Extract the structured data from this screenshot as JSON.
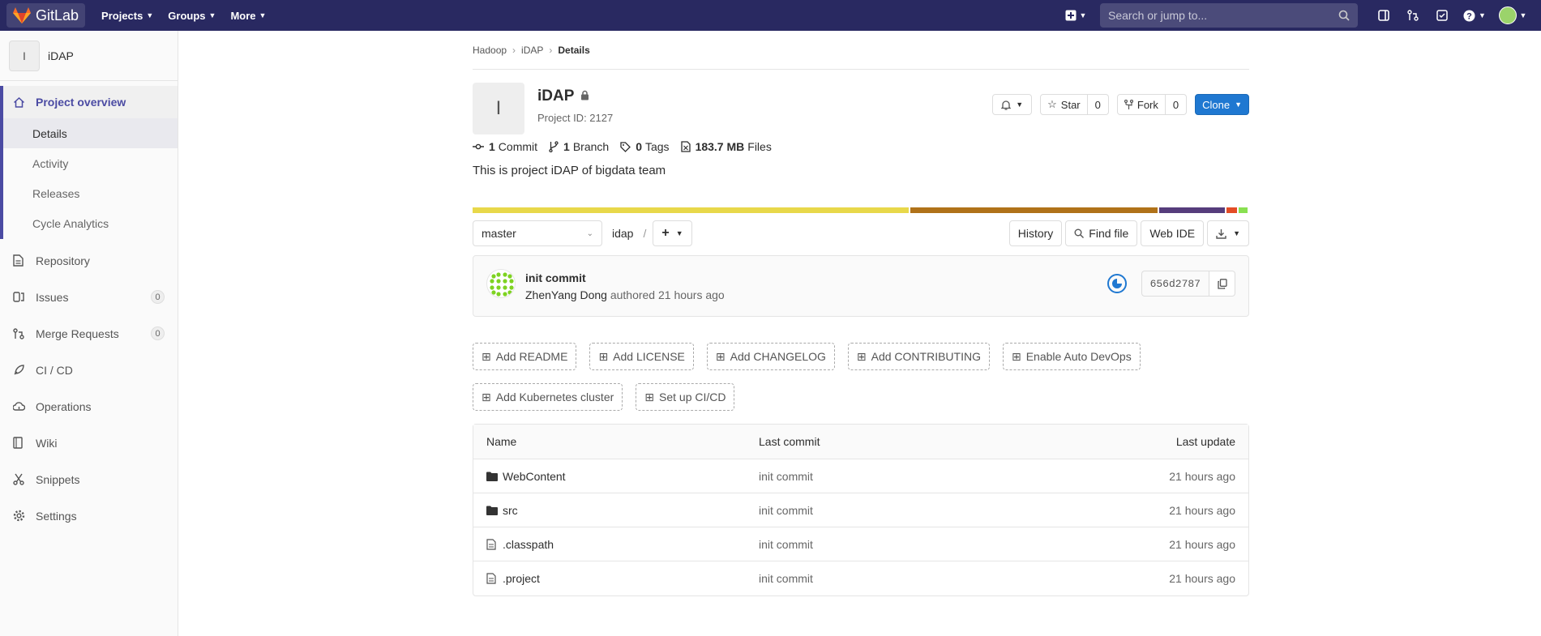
{
  "navbar": {
    "brand": "GitLab",
    "menus": [
      "Projects",
      "Groups",
      "More"
    ],
    "search_placeholder": "Search or jump to..."
  },
  "sidebar": {
    "project_initial": "I",
    "project_name": "iDAP",
    "overview_label": "Project overview",
    "overview_items": [
      "Details",
      "Activity",
      "Releases",
      "Cycle Analytics"
    ],
    "items": [
      {
        "label": "Repository"
      },
      {
        "label": "Issues",
        "count": "0"
      },
      {
        "label": "Merge Requests",
        "count": "0"
      },
      {
        "label": "CI / CD"
      },
      {
        "label": "Operations"
      },
      {
        "label": "Wiki"
      },
      {
        "label": "Snippets"
      },
      {
        "label": "Settings"
      }
    ]
  },
  "breadcrumb": [
    "Hadoop",
    "iDAP",
    "Details"
  ],
  "project": {
    "initial": "I",
    "name": "iDAP",
    "id_text": "Project ID: 2127",
    "star_label": "Star",
    "star_count": "0",
    "fork_label": "Fork",
    "fork_count": "0",
    "clone_label": "Clone",
    "description": "This is project iDAP of bigdata team"
  },
  "stats": {
    "commits_num": "1",
    "commits_label": "Commit",
    "branches_num": "1",
    "branches_label": "Branch",
    "tags_num": "0",
    "tags_label": "Tags",
    "size_num": "183.7 MB",
    "size_label": "Files"
  },
  "languages": [
    {
      "share": 56.7,
      "color": "#e8d84a"
    },
    {
      "share": 32.2,
      "color": "#b07219"
    },
    {
      "share": 8.6,
      "color": "#563d7c"
    },
    {
      "share": 1.3,
      "color": "#e34c26"
    },
    {
      "share": 1.2,
      "color": "#89e051"
    }
  ],
  "tree": {
    "branch": "master",
    "path": "idap",
    "history_label": "History",
    "find_file_label": "Find file",
    "web_ide_label": "Web IDE"
  },
  "commit": {
    "title": "init commit",
    "author": "ZhenYang Dong",
    "meta": "authored 21 hours ago",
    "sha": "656d2787"
  },
  "quick_actions": [
    "Add README",
    "Add LICENSE",
    "Add CHANGELOG",
    "Add CONTRIBUTING",
    "Enable Auto DevOps",
    "Add Kubernetes cluster",
    "Set up CI/CD"
  ],
  "files": {
    "headers": {
      "name": "Name",
      "last_commit": "Last commit",
      "last_update": "Last update"
    },
    "rows": [
      {
        "type": "folder",
        "name": "WebContent",
        "commit": "init commit",
        "updated": "21 hours ago"
      },
      {
        "type": "folder",
        "name": "src",
        "commit": "init commit",
        "updated": "21 hours ago"
      },
      {
        "type": "file",
        "name": ".classpath",
        "commit": "init commit",
        "updated": "21 hours ago"
      },
      {
        "type": "file",
        "name": ".project",
        "commit": "init commit",
        "updated": "21 hours ago"
      }
    ]
  }
}
